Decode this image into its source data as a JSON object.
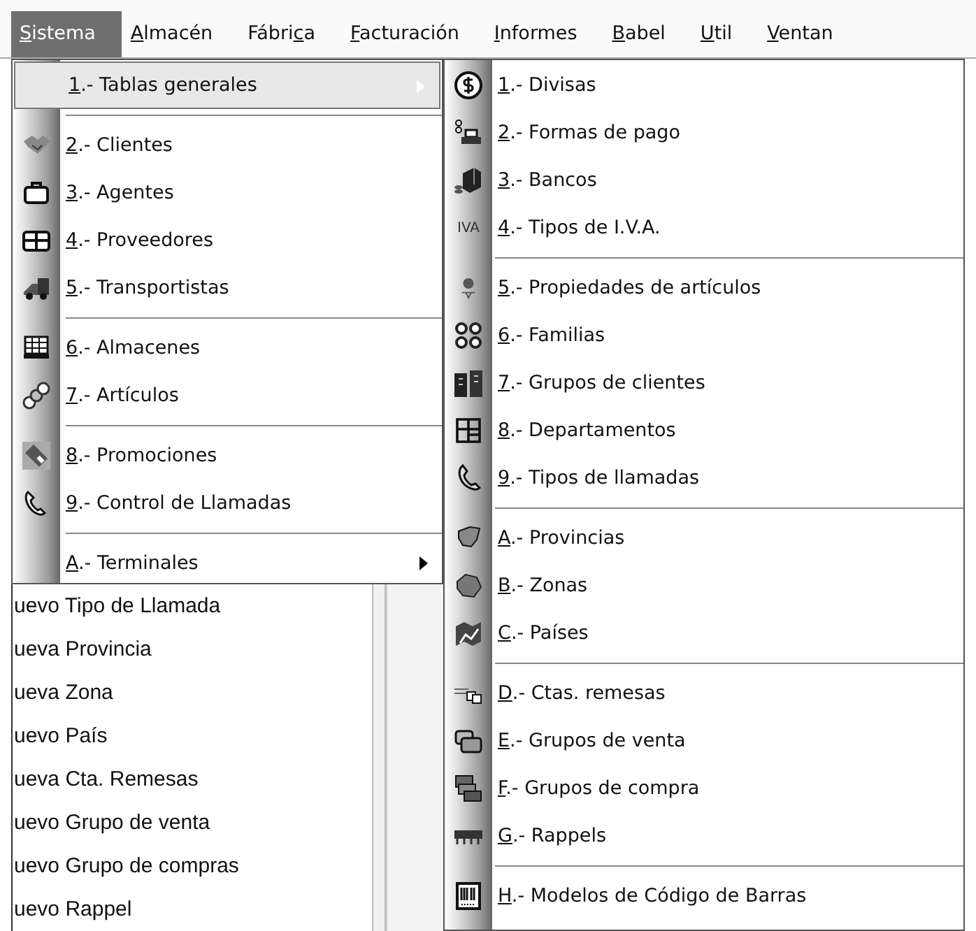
{
  "menubar": [
    {
      "key": "S",
      "rest": "istema",
      "selected": true
    },
    {
      "key": "A",
      "rest": "lmacén",
      "selected": false
    },
    {
      "pre": "Fábri",
      "key": "c",
      "rest": "a",
      "selected": false
    },
    {
      "key": "F",
      "rest": "acturación",
      "selected": false
    },
    {
      "key": "I",
      "rest": "nformes",
      "selected": false
    },
    {
      "key": "B",
      "rest": "abel",
      "selected": false
    },
    {
      "key": "U",
      "rest": "til",
      "selected": false
    },
    {
      "key": "V",
      "rest": "entan",
      "selected": false
    }
  ],
  "menu": {
    "groups": [
      [
        {
          "label": "1.- Tablas generales",
          "selected": true,
          "submenu": true
        }
      ],
      [
        {
          "label": "2.- Clientes",
          "selected": false,
          "submenu": false
        },
        {
          "label": "3.- Agentes",
          "selected": false,
          "submenu": false
        },
        {
          "label": "4.- Proveedores",
          "selected": false,
          "submenu": false
        },
        {
          "label": "5.- Transportistas",
          "selected": false,
          "submenu": false
        }
      ],
      [
        {
          "label": "6.- Almacenes",
          "selected": false,
          "submenu": false
        },
        {
          "label": "7.- Artículos",
          "selected": false,
          "submenu": false
        }
      ],
      [
        {
          "label": "8.- Promociones",
          "selected": false,
          "submenu": false
        },
        {
          "label": "9.- Control de Llamadas",
          "selected": false,
          "submenu": false
        }
      ],
      [
        {
          "label": "A.- Terminales",
          "selected": false,
          "submenu": true
        }
      ]
    ]
  },
  "submenu": {
    "groups": [
      [
        {
          "label": "1.- Divisas"
        },
        {
          "label": "2.- Formas de pago"
        },
        {
          "label": "3.- Bancos"
        },
        {
          "label": "4.- Tipos de I.V.A.",
          "icon_text": "IVA"
        }
      ],
      [
        {
          "label": "5.- Propiedades de artículos"
        },
        {
          "label": "6.- Familias"
        },
        {
          "label": "7.- Grupos de clientes"
        },
        {
          "label": "8.- Departamentos"
        },
        {
          "label": "9.- Tipos de llamadas"
        }
      ],
      [
        {
          "label": "A.- Provincias"
        },
        {
          "label": "B.- Zonas"
        },
        {
          "label": "C.- Países"
        }
      ],
      [
        {
          "label": "D.- Ctas. remesas"
        },
        {
          "label": "E.- Grupos de venta"
        },
        {
          "label": "F.- Grupos de compra"
        },
        {
          "label": "G.- Rappels"
        }
      ],
      [
        {
          "label": "H.- Modelos de Código de Barras"
        }
      ]
    ]
  },
  "background_list": [
    "uevo Tipo de Llamada",
    "ueva Provincia",
    "ueva Zona",
    "uevo País",
    "ueva Cta. Remesas",
    "uevo Grupo de venta",
    "uevo Grupo de compras",
    "uevo Rappel"
  ]
}
